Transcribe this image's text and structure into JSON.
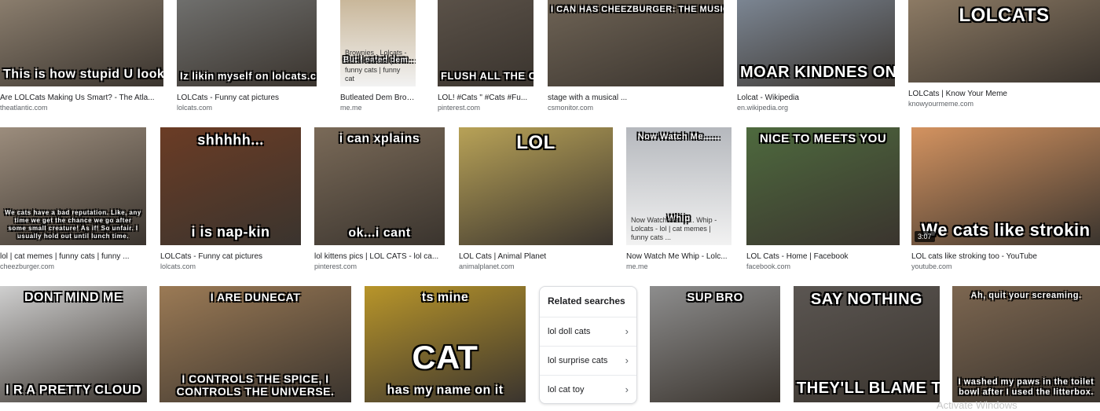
{
  "images": [
    {
      "id": "atlantic",
      "title": "Are LOLCats Making Us Smart? - The Atla...",
      "domain": "theatlantic.com",
      "caption_bottom": "This is how stupid U look",
      "bg": "#8a7d6d"
    },
    {
      "id": "lolcats-funny",
      "title": "LOLCats - Funny cat pictures",
      "domain": "lolcats.com",
      "caption_bottom": "Iz likin myself on lolcats.com",
      "bg": "#6f6f6d"
    },
    {
      "id": "butleated",
      "title": "Butleated Dem Brownie...",
      "domain": "me.me",
      "caption_bottom": "But I eated dem...",
      "thumb_text": "Brownies . Lolcats - lol cat memes | funny cats | funny cat",
      "bg": "#c9b79a"
    },
    {
      "id": "flush",
      "title": "LOL! #Cats \" #Cats #Fu...",
      "domain": "pinterest.com",
      "caption_bottom": "FLUSH ALL THE CATNIP",
      "bg": "#5a5148"
    },
    {
      "id": "cheezburger-stage",
      "title": "stage with a musical ...",
      "domain": "csmonitor.com",
      "caption_top": "I CAN HAS CHEEZBURGER: THE MUSICLOL!",
      "bg": "#6e6355"
    },
    {
      "id": "wikipedia",
      "title": "Lolcat - Wikipedia",
      "domain": "en.wikipedia.org",
      "caption_bottom": "MOAR KINDNES ON WIKIPEDIA?",
      "bg": "#7b8592"
    },
    {
      "id": "knowyourmeme",
      "title": "LOLCats | Know Your Meme",
      "domain": "knowyourmeme.com",
      "caption_top": "LOLCATS",
      "bg": "#8c7a64"
    },
    {
      "id": "cheezburger-memes",
      "title": "lol | cat memes | funny cats | funny ...",
      "domain": "cheezburger.com",
      "caption_bottom": "We cats have a bad reputation. Like, any time we get the chance we go after some small creature! As if! So unfair. I usually hold out until lunch time.",
      "bg": "#9c8d7d"
    },
    {
      "id": "napkin",
      "title": "LOLCats - Funny cat pictures",
      "domain": "lolcats.com",
      "caption_top": "shhhhh...",
      "caption_bottom": "i is nap-kin",
      "bg": "#6b3c25"
    },
    {
      "id": "xplains",
      "title": "lol kittens pics | LOL CATS - lol ca...",
      "domain": "pinterest.com",
      "caption_top": "i can xplains",
      "caption_bottom": "ok...i cant",
      "bg": "#7a6a58"
    },
    {
      "id": "animalplanet",
      "title": "LOL Cats | Animal Planet",
      "domain": "animalplanet.com",
      "caption_top": "LOL",
      "bg": "#b8a257"
    },
    {
      "id": "whip",
      "title": "Now Watch Me Whip - Lolc...",
      "domain": "me.me",
      "caption_top": "Now Watch Me......",
      "caption_bottom": "Whip",
      "thumb_text": "Now Watch Me........ Whip - Lolcats - lol | cat memes | funny cats ...",
      "bg": "#b5b8bd"
    },
    {
      "id": "nicetomeet",
      "title": "LOL Cats - Home | Facebook",
      "domain": "facebook.com",
      "caption_top": "NICE TO MEETS YOU",
      "bg": "#4e6a3e"
    },
    {
      "id": "stroking",
      "title": "LOL cats like stroking too - YouTube",
      "domain": "youtube.com",
      "caption_bottom": "We cats like strokin",
      "duration": "3:07",
      "bg": "#d49360"
    },
    {
      "id": "dontmindme",
      "caption_top": "DONT MIND ME",
      "caption_bottom": "I R A PRETTY CLOUD",
      "bg": "#cfcfcf"
    },
    {
      "id": "dunecat",
      "caption_top": "I ARE DUNECAT",
      "caption_bottom": "I CONTROLS THE SPICE, I CONTROLS THE UNIVERSE.",
      "bg": "#9b7a55"
    },
    {
      "id": "caterpillar",
      "caption_top": "ts mine",
      "caption_mid": "CAT",
      "caption_bottom": "has my name on it",
      "bg": "#b8952a"
    },
    {
      "id": "supbro",
      "caption_top": "SUP BRO",
      "bg": "#8d8d8d"
    },
    {
      "id": "saynothing",
      "caption_top": "SAY NOTHING",
      "caption_bottom": "THEY'LL BLAME THE DOG",
      "bg": "#5b5652"
    },
    {
      "id": "screaming",
      "caption_top": "Ah, quit your screaming.",
      "caption_bottom": "I washed my paws in the toilet bowl after I used the litterbox.",
      "bg": "#7c6650"
    }
  ],
  "related": {
    "title": "Related searches",
    "items": [
      {
        "label": "lol doll cats",
        "chevron": "›"
      },
      {
        "label": "lol surprise cats",
        "chevron": "›"
      },
      {
        "label": "lol cat toy",
        "chevron": "›"
      }
    ]
  },
  "watermark": "Activate Windows"
}
